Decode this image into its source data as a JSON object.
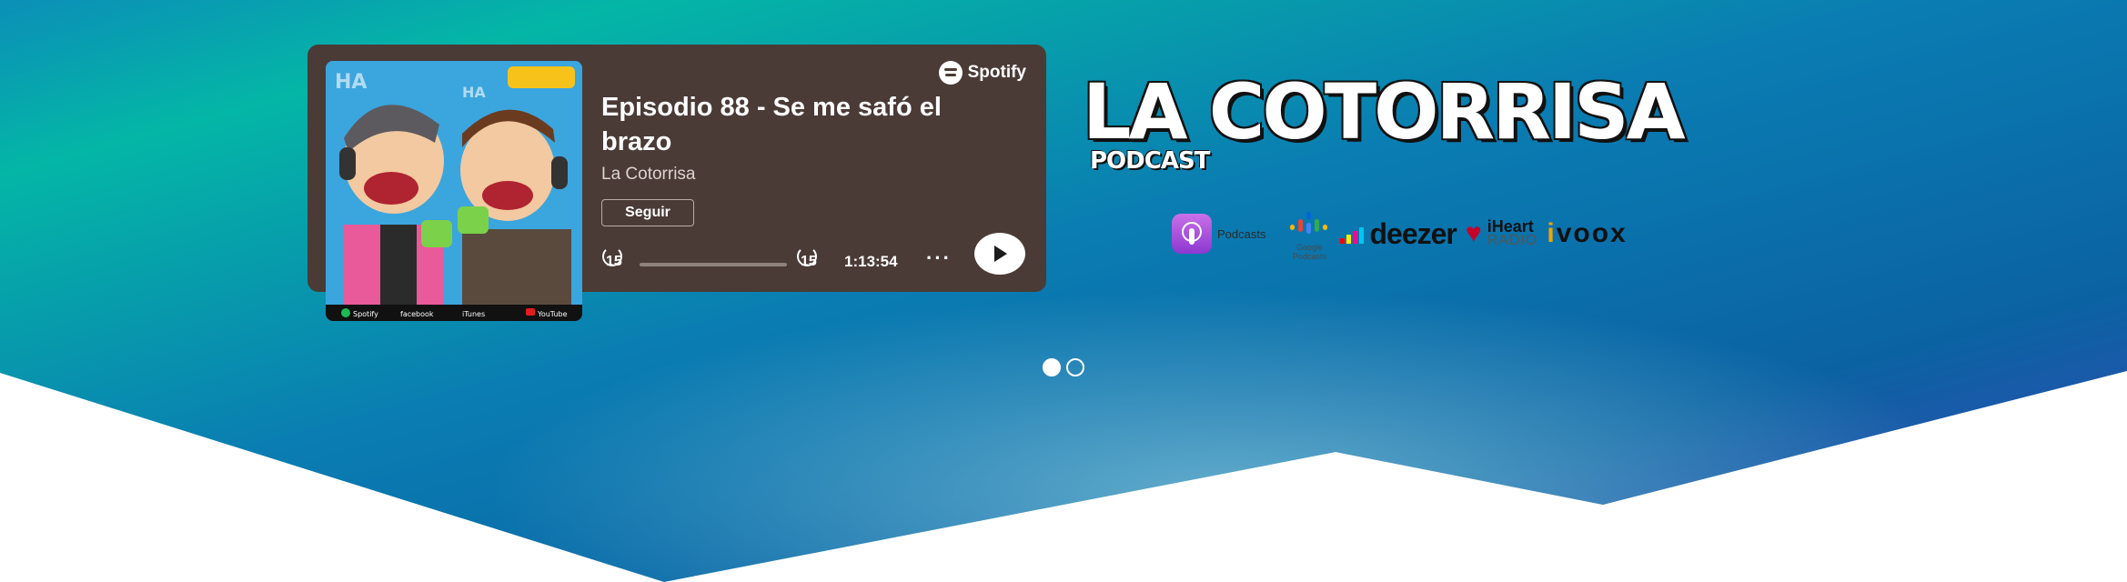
{
  "player": {
    "brand": "Spotify",
    "episode_title": "Episodio 88 - Se me safó el brazo",
    "show_name": "La Cotorrisa",
    "follow_label": "Seguir",
    "skip_back_label": "15",
    "skip_forward_label": "15",
    "duration": "1:13:54",
    "more_label": "···",
    "progress": 0,
    "cover_footer": [
      "Spotify",
      "facebook",
      "iTunes",
      "YouTube"
    ]
  },
  "brand": {
    "title": "LA COTORRISA",
    "subtitle": "PODCAST"
  },
  "platforms": {
    "apple_label": "Podcasts",
    "google_label": "Google Podcasts",
    "deezer_label": "deezer",
    "iheart_label_top": "iHeart",
    "iheart_label_bottom": "RADIO",
    "ivoox_label": "voox",
    "ivoox_letter": "i"
  },
  "carousel": {
    "slides": 2,
    "active": 0
  },
  "colors": {
    "card_bg": "#4a3b36",
    "hero_gradient": [
      "#04b4a4",
      "#0a7fb0",
      "#0b5d9e",
      "#3b4fb8"
    ],
    "deezer": [
      "#ff0000",
      "#ffed00",
      "#ff0092",
      "#c2ff00",
      "#00c7f2",
      "#c1f1fc"
    ],
    "iheart": "#c6002b",
    "ivoox": "#f4a300"
  }
}
